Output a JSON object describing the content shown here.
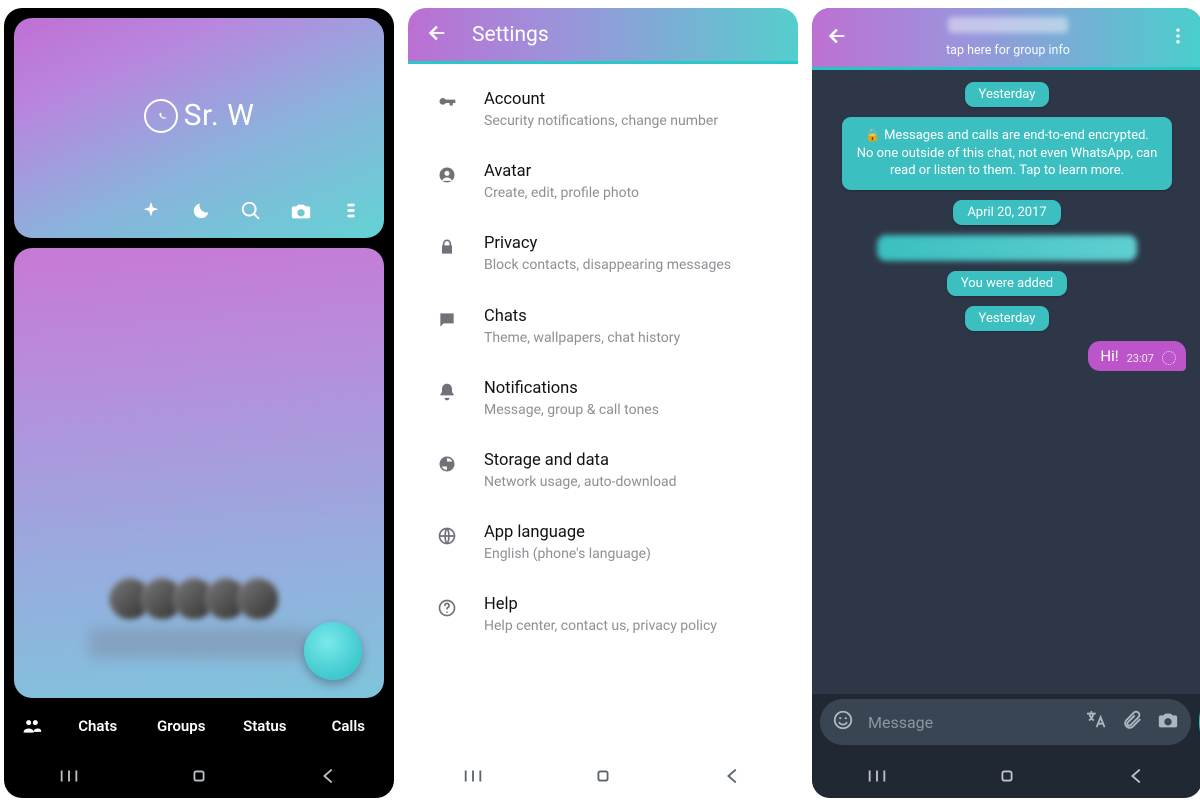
{
  "home": {
    "app_name": "Sr. W",
    "tabs": [
      "Chats",
      "Groups",
      "Status",
      "Calls"
    ]
  },
  "settings": {
    "title": "Settings",
    "items": [
      {
        "title": "Account",
        "subtitle": "Security notifications, change number",
        "icon": "key-icon"
      },
      {
        "title": "Avatar",
        "subtitle": "Create, edit, profile photo",
        "icon": "avatar-icon"
      },
      {
        "title": "Privacy",
        "subtitle": "Block contacts, disappearing messages",
        "icon": "lock-icon"
      },
      {
        "title": "Chats",
        "subtitle": "Theme, wallpapers, chat history",
        "icon": "chat-icon"
      },
      {
        "title": "Notifications",
        "subtitle": "Message, group & call tones",
        "icon": "bell-icon"
      },
      {
        "title": "Storage and data",
        "subtitle": "Network usage, auto-download",
        "icon": "data-icon"
      },
      {
        "title": "App language",
        "subtitle": "English (phone's language)",
        "icon": "globe-icon"
      },
      {
        "title": "Help",
        "subtitle": "Help center, contact us, privacy policy",
        "icon": "help-icon"
      }
    ]
  },
  "chat": {
    "header_subtitle": "tap here for group info",
    "date_pill_1": "Yesterday",
    "encryption_notice": "Messages and calls are end-to-end encrypted. No one outside of this chat, not even WhatsApp, can read or listen to them. Tap to learn more.",
    "date_pill_2": "April 20, 2017",
    "system_msg_added": "You were added",
    "date_pill_3": "Yesterday",
    "outgoing_msg": "Hi!",
    "outgoing_time": "23:07",
    "input_placeholder": "Message"
  }
}
